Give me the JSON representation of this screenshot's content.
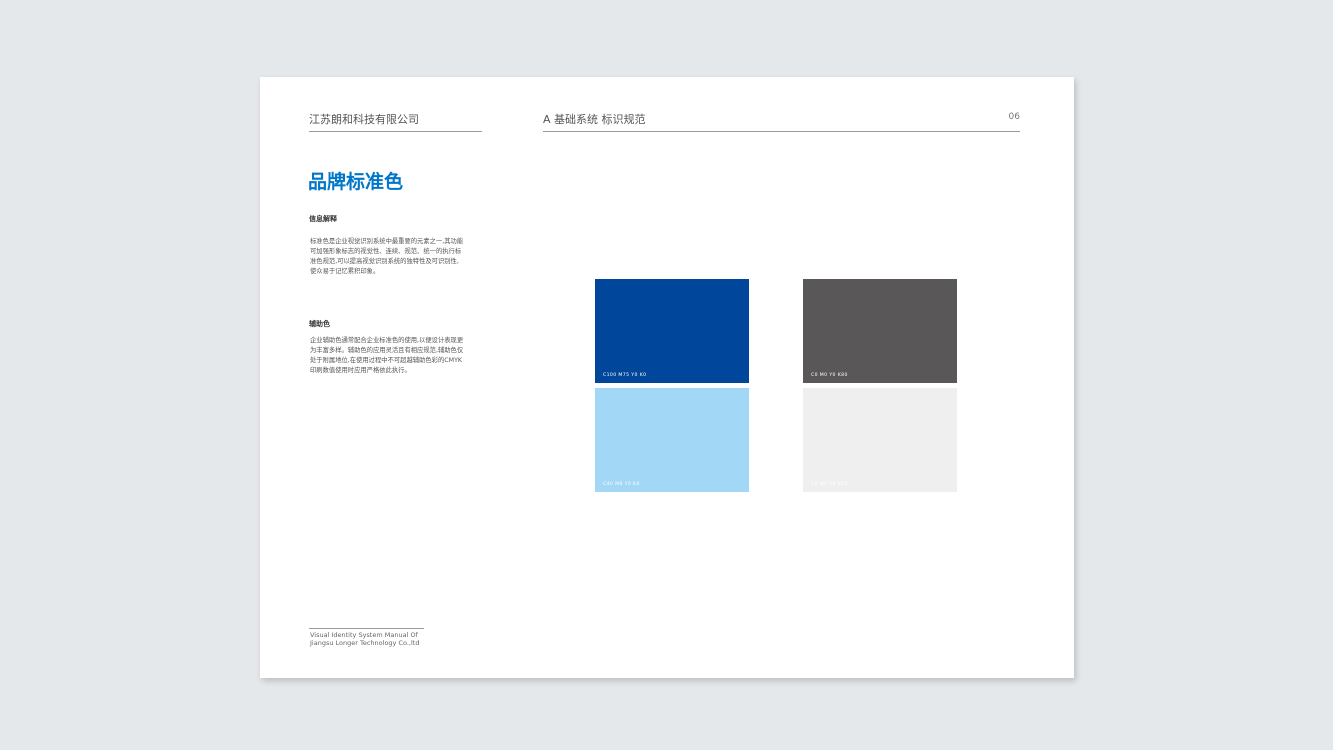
{
  "header": {
    "company": "江苏朗和科技有限公司",
    "section": "A 基础系统 标识规范",
    "page_number": "06"
  },
  "title": "品牌标准色",
  "info": {
    "heading": "信息解释",
    "text": "标准色是企业视觉识别系统中最重要的元素之一,其功能可加强形象标志的视觉性、连续、规范、统一的执行标准色规范,可以提高视觉识别系统的独特性及可识别性,使众易于记忆累积印象。"
  },
  "auxiliary": {
    "heading": "辅助色",
    "text": "企业辅助色通常配合企业标准色的使用,以便设计表现更为丰富多样。辅助色的应用灵活且有相应规范,辅助色仅处于附属地位,在使用过程中不可超越辅助色彩的CMYK印刷数值使用时应用严格依此执行。"
  },
  "swatches": [
    {
      "code": "C100 M75 Y0 K0",
      "color": "#00469b",
      "code_color": "#ffffff"
    },
    {
      "code": "C0 M0 Y0 K80",
      "color": "#595757",
      "code_color": "#ffffff"
    },
    {
      "code": "C40 M0 Y0 K0",
      "color": "#a2d7f5",
      "code_color": "#ffffff"
    },
    {
      "code": "C0 M0 Y0 K10",
      "color": "#efefef",
      "code_color": "#ffffff"
    }
  ],
  "footer": {
    "line1": "Visual Identity System Manual Of",
    "line2": "Jiangsu Longer Technology Co.,ltd"
  }
}
